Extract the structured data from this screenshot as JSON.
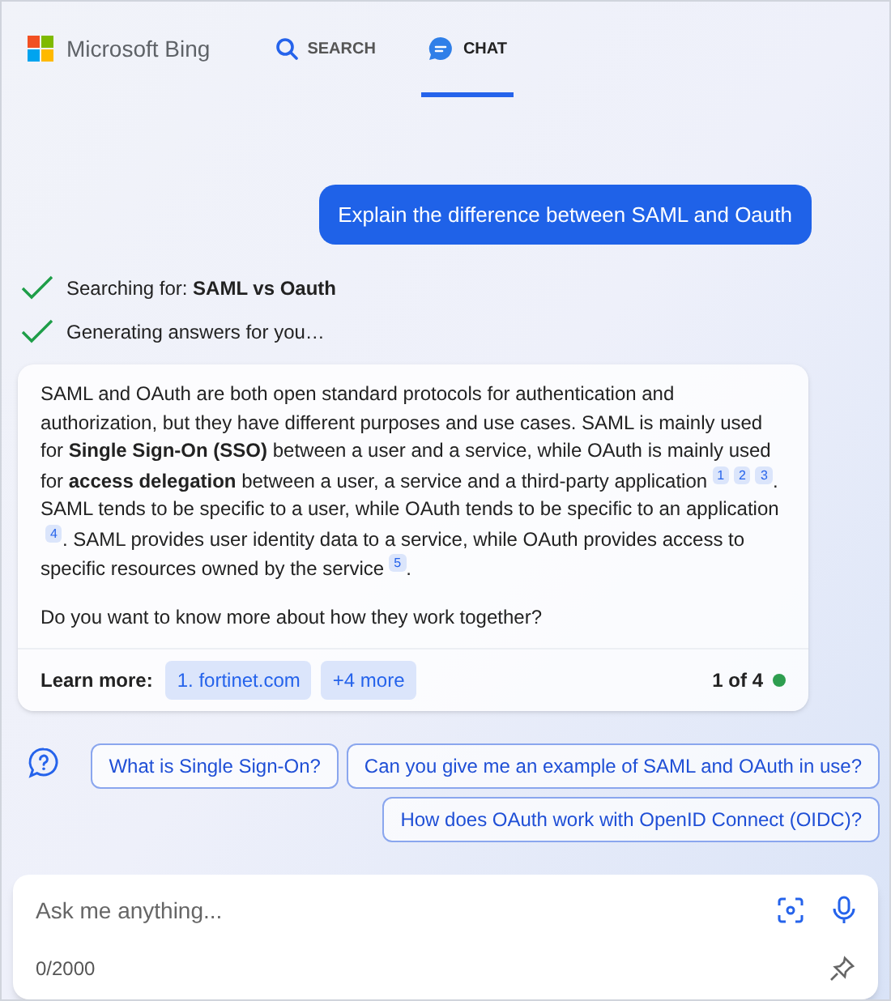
{
  "header": {
    "brand": "Microsoft Bing",
    "tabs": [
      {
        "label": "SEARCH",
        "kind": "search",
        "selected": false
      },
      {
        "label": "CHAT",
        "kind": "chat",
        "selected": true
      }
    ]
  },
  "user_message": "Explain the difference between SAML and Oauth",
  "progress": [
    {
      "text": "Searching for: **SAML vs Oauth**",
      "done": true
    },
    {
      "text": "Generating answers for you…",
      "done": true
    }
  ],
  "answer": {
    "segments": [
      {
        "kind": "text",
        "text": "SAML and OAuth are both open standard protocols for authentication and authorization, but they have different purposes and use cases. SAML is mainly used for **Single Sign-On (SSO)** between a user and a service, while OAuth is mainly used for **access delegation** between a user, a service and a third-party application"
      },
      {
        "kind": "cite",
        "text": "1"
      },
      {
        "kind": "cite",
        "text": "2"
      },
      {
        "kind": "cite",
        "text": "3"
      },
      {
        "kind": "text",
        "text": ". SAML tends to be specific to a user, while OAuth tends to be specific to an application"
      },
      {
        "kind": "cite",
        "text": "4"
      },
      {
        "kind": "text",
        "text": ". SAML provides user identity data to a service, while OAuth provides access to specific resources owned by the service"
      },
      {
        "kind": "cite",
        "text": "5"
      },
      {
        "kind": "text",
        "text": "."
      }
    ],
    "question": "Do you want to know more about how they work together?",
    "learn_more_label": "Learn more:",
    "sources": [
      "1. fortinet.com",
      "+4 more"
    ],
    "page": "1 of 4",
    "status": {
      "color": "#2e9e4f"
    }
  },
  "suggestions": [
    "What is Single Sign-On?",
    "Can you give me an example of SAML and OAuth in use?",
    "How does OAuth work with OpenID Connect (OIDC)?"
  ],
  "input": {
    "placeholder": "Ask me anything...",
    "counter": "0/2000"
  }
}
